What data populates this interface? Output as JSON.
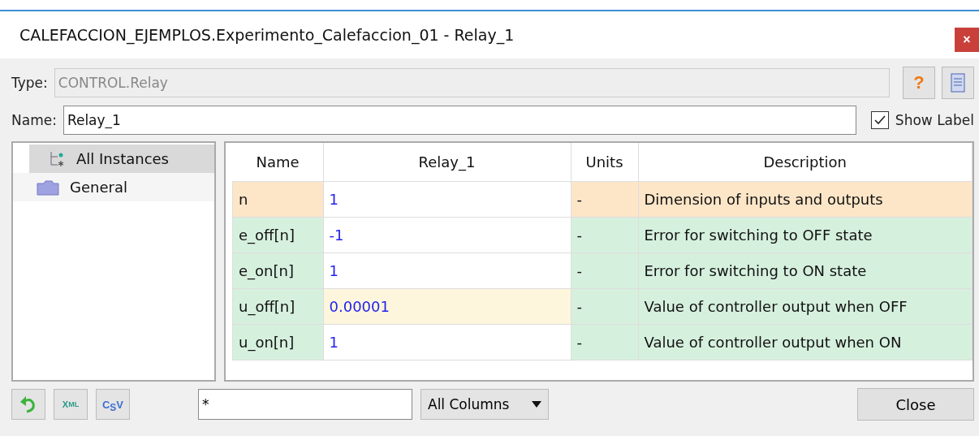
{
  "window": {
    "title": "CALEFACCION_EJEMPLOS.Experimento_Calefaccion_01 - Relay_1",
    "close": "×"
  },
  "type_field": {
    "label": "Type:",
    "value": "CONTROL.Relay",
    "disabled": true
  },
  "help_button": "?",
  "name_field": {
    "label": "Name:",
    "value": "Relay_1"
  },
  "show_label": {
    "label": "Show Label",
    "checked": true
  },
  "tree": [
    {
      "label": "All Instances",
      "selected": true,
      "kind": "instances"
    },
    {
      "label": "General",
      "selected": false,
      "kind": "folder"
    }
  ],
  "table": {
    "columns": [
      "Name",
      "Relay_1",
      "Units",
      "Description"
    ],
    "rows": [
      {
        "name": "n",
        "value": "1",
        "units": "-",
        "description": "Dimension of inputs and outputs",
        "color": "#fde6c8",
        "edited": false
      },
      {
        "name": "e_off[n]",
        "value": "-1",
        "units": "-",
        "description": "Error for switching to OFF state",
        "color": "#d6f0de",
        "edited": false
      },
      {
        "name": "e_on[n]",
        "value": "1",
        "units": "-",
        "description": "Error for switching to ON state",
        "color": "#d6f0de",
        "edited": false
      },
      {
        "name": "u_off[n]",
        "value": "0.00001",
        "units": "-",
        "description": "Value of controller output when OFF",
        "color": "#d6f0de",
        "edited": true
      },
      {
        "name": "u_on[n]",
        "value": "1",
        "units": "-",
        "description": "Value of controller output when ON",
        "color": "#d6f0de",
        "edited": false
      }
    ]
  },
  "toolbar": [
    {
      "kind": "undo"
    },
    {
      "kind": "xml",
      "top": "X",
      "sub": "ML"
    },
    {
      "kind": "csv",
      "top": "C",
      "sub": "S",
      "tail": "V"
    }
  ],
  "filter": {
    "value": "*"
  },
  "column_select": {
    "value": "All Columns"
  },
  "close_button": "Close"
}
